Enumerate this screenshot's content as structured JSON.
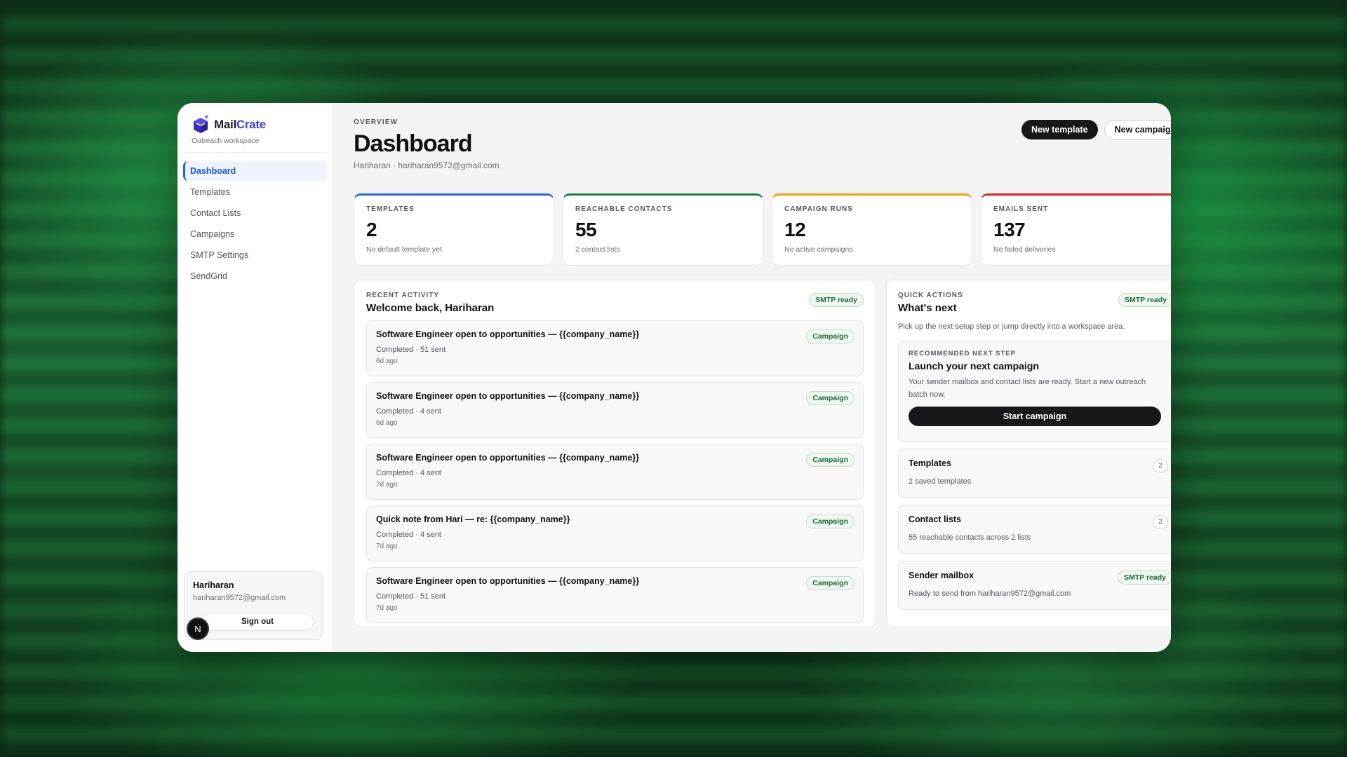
{
  "brand": {
    "name_a": "Mail",
    "name_b": "Crate",
    "subtitle": "Outreach workspace"
  },
  "nav": [
    {
      "label": "Dashboard",
      "active": true
    },
    {
      "label": "Templates"
    },
    {
      "label": "Contact Lists"
    },
    {
      "label": "Campaigns"
    },
    {
      "label": "SMTP Settings"
    },
    {
      "label": "SendGrid"
    }
  ],
  "user": {
    "name": "Hariharan",
    "email": "hariharan9572@gmail.com",
    "signout_label": "Sign out",
    "badge": "N"
  },
  "header": {
    "overline": "OVERVIEW",
    "title": "Dashboard",
    "subtitle": "Hariharan · hariharan9572@gmail.com",
    "new_template_label": "New template",
    "new_campaign_label": "New campaign"
  },
  "stats": [
    {
      "label": "TEMPLATES",
      "value": "2",
      "note": "No default template yet",
      "color": "#2563eb"
    },
    {
      "label": "REACHABLE CONTACTS",
      "value": "55",
      "note": "2 contact lists",
      "color": "#15803d"
    },
    {
      "label": "CAMPAIGN RUNS",
      "value": "12",
      "note": "No active campaigns",
      "color": "#f59e0b"
    },
    {
      "label": "EMAILS SENT",
      "value": "137",
      "note": "No failed deliveries",
      "color": "#dc2626"
    }
  ],
  "activity": {
    "overline": "RECENT ACTIVITY",
    "title": "Welcome back, Hariharan",
    "status_pill": "SMTP ready",
    "items": [
      {
        "title": "Software Engineer open to opportunities — {{company_name}}",
        "status": "Completed · 51 sent",
        "time": "6d ago",
        "tag": "Campaign"
      },
      {
        "title": "Software Engineer open to opportunities — {{company_name}}",
        "status": "Completed · 4 sent",
        "time": "6d ago",
        "tag": "Campaign"
      },
      {
        "title": "Software Engineer open to opportunities — {{company_name}}",
        "status": "Completed · 4 sent",
        "time": "7d ago",
        "tag": "Campaign"
      },
      {
        "title": "Quick note from Hari — re: {{company_name}}",
        "status": "Completed · 4 sent",
        "time": "7d ago",
        "tag": "Campaign"
      },
      {
        "title": "Software Engineer open to opportunities — {{company_name}}",
        "status": "Completed · 51 sent",
        "time": "7d ago",
        "tag": "Campaign"
      }
    ]
  },
  "quick": {
    "overline": "QUICK ACTIONS",
    "title": "What's next",
    "status_pill": "SMTP ready",
    "description": "Pick up the next setup step or jump directly into a workspace area.",
    "recommended": {
      "overline": "RECOMMENDED NEXT STEP",
      "title": "Launch your next campaign",
      "description": "Your sender mailbox and contact lists are ready. Start a new outreach batch now.",
      "button_label": "Start campaign"
    },
    "templates": {
      "title": "Templates",
      "description": "2 saved templates",
      "count": "2"
    },
    "contact_lists": {
      "title": "Contact lists",
      "description": "55 reachable contacts across 2 lists",
      "count": "2"
    },
    "sender": {
      "title": "Sender mailbox",
      "description": "Ready to send from hariharan9572@gmail.com",
      "pill": "SMTP ready"
    }
  }
}
